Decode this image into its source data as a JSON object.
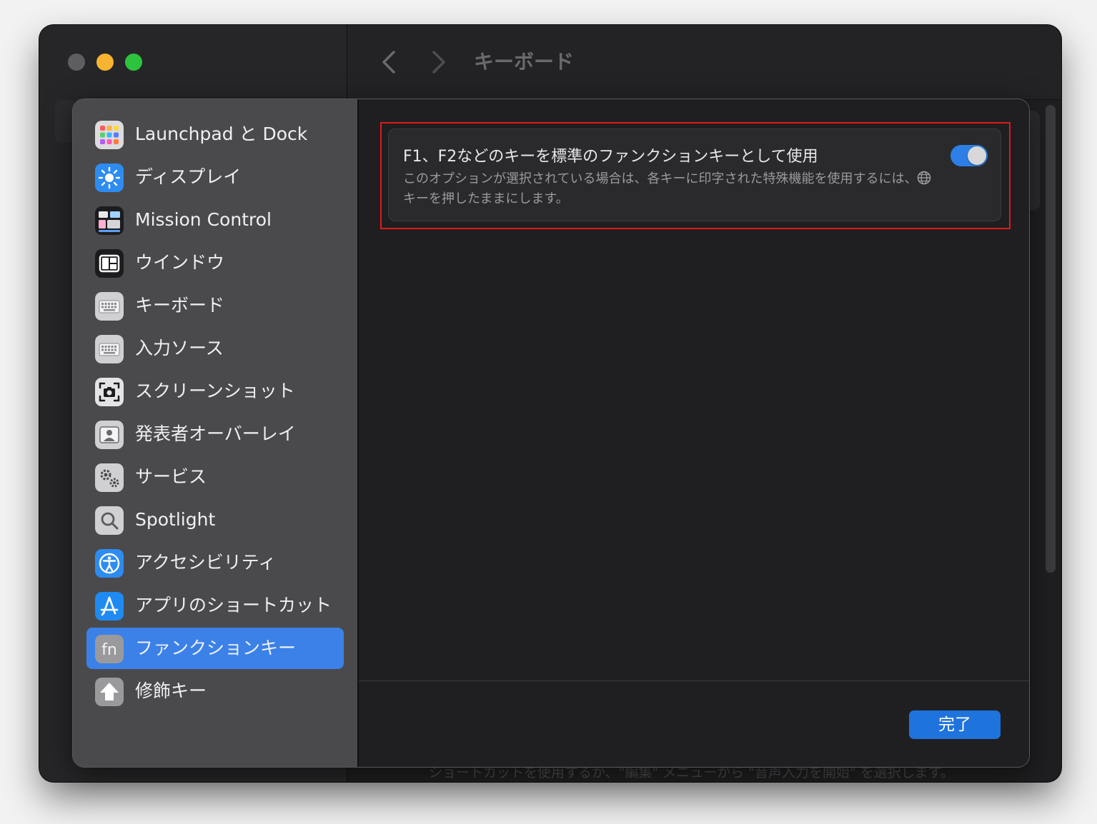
{
  "window": {
    "title": "キーボード",
    "background_hint": "ショートカットを使用するか、\"編集\" メニューから \"音声入力を開始\" を選択します。"
  },
  "sidebar": {
    "items": [
      {
        "label": "Launchpad と Dock",
        "icon": "launchpad-icon"
      },
      {
        "label": "ディスプレイ",
        "icon": "display-brightness-icon"
      },
      {
        "label": "Mission Control",
        "icon": "mission-control-icon"
      },
      {
        "label": "ウインドウ",
        "icon": "window-layout-icon"
      },
      {
        "label": "キーボード",
        "icon": "keyboard-icon"
      },
      {
        "label": "入力ソース",
        "icon": "input-source-icon"
      },
      {
        "label": "スクリーンショット",
        "icon": "screenshot-icon"
      },
      {
        "label": "発表者オーバーレイ",
        "icon": "presenter-overlay-icon"
      },
      {
        "label": "サービス",
        "icon": "services-gear-icon"
      },
      {
        "label": "Spotlight",
        "icon": "spotlight-search-icon"
      },
      {
        "label": "アクセシビリティ",
        "icon": "accessibility-icon"
      },
      {
        "label": "アプリのショートカット",
        "icon": "app-shortcuts-icon"
      },
      {
        "label": "ファンクションキー",
        "icon": "fn-key-icon",
        "selected": true
      },
      {
        "label": "修飾キー",
        "icon": "modifier-keys-icon"
      }
    ]
  },
  "option": {
    "title": "F1、F2などのキーを標準のファンクションキーとして使用",
    "desc_part1": "このオプションが選択されている場合は、各キーに印字された特殊機能を使用するには、",
    "desc_part2": "キーを押したままにします。",
    "toggle_on": true
  },
  "footer": {
    "done_label": "完了"
  },
  "colors": {
    "accent": "#1e73dc",
    "selection": "#3b81e8",
    "highlight_border": "#e01a1a"
  }
}
